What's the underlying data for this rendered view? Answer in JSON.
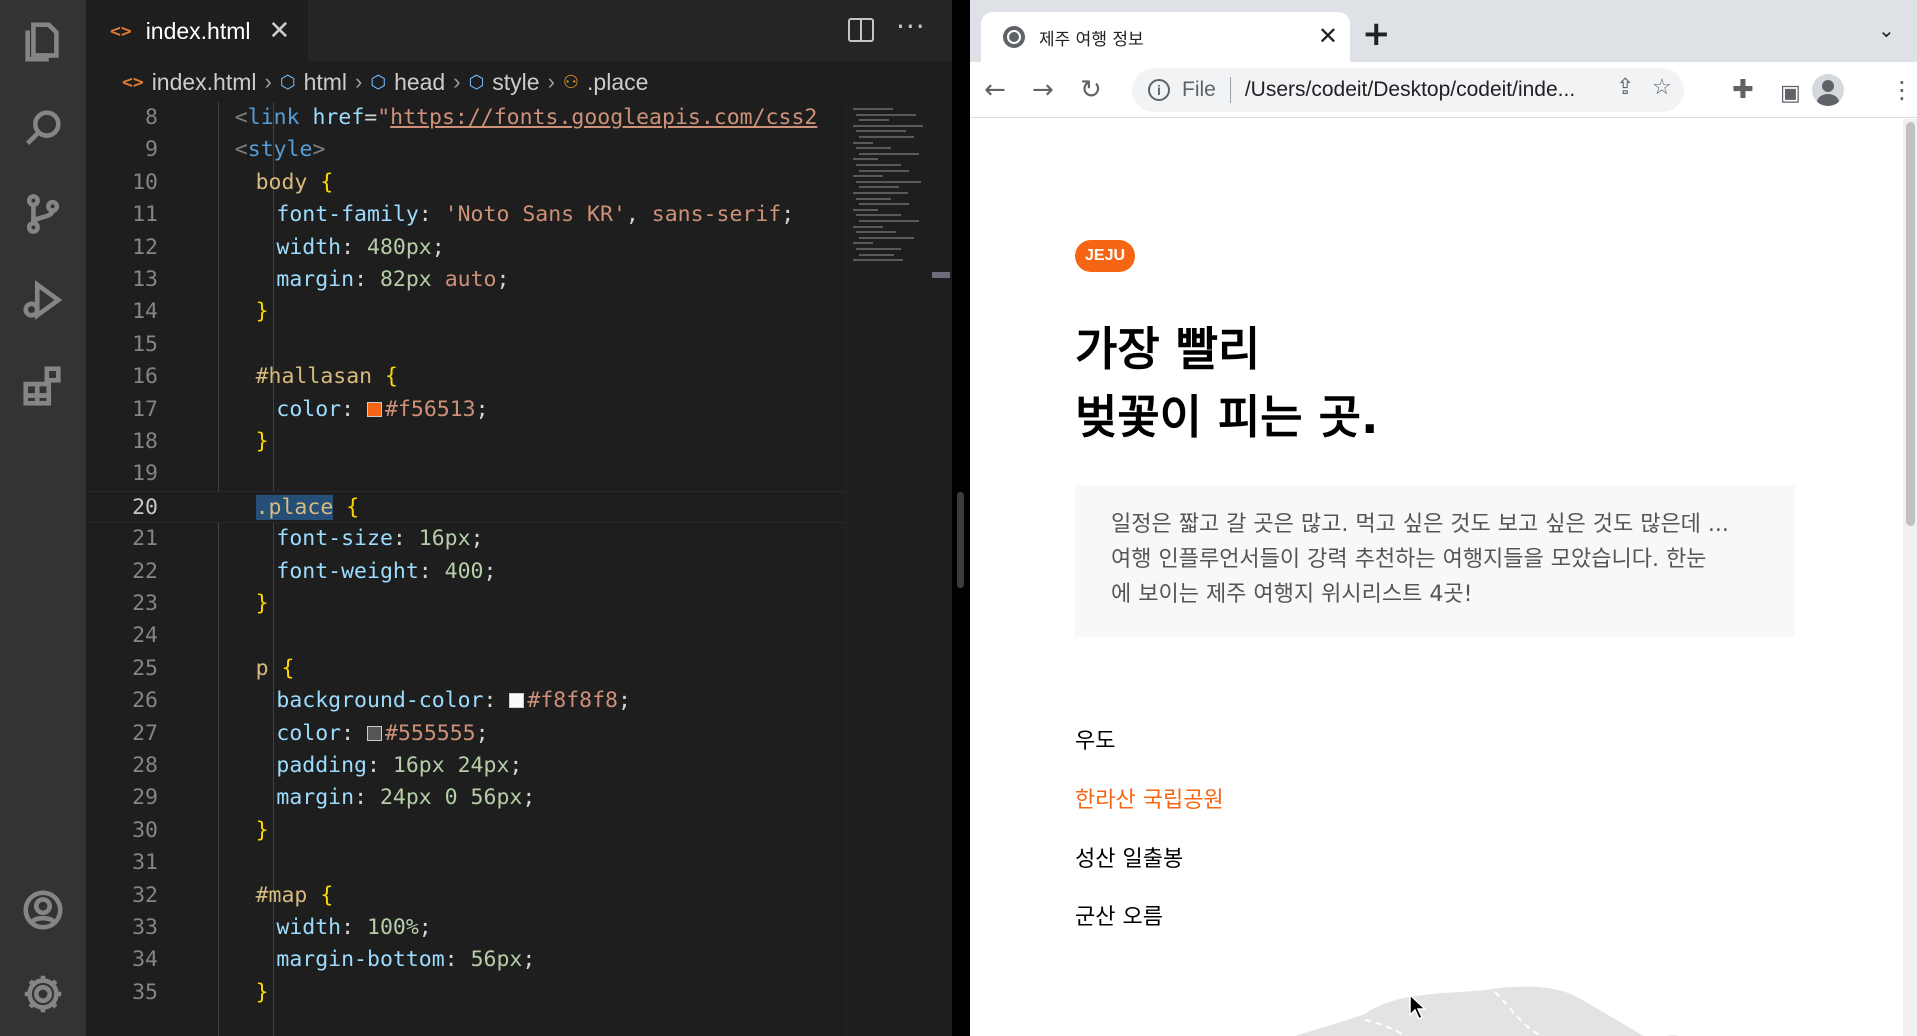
{
  "vscode": {
    "tab": {
      "icon": "<>",
      "label": "index.html",
      "close": "✕"
    },
    "breadcrumb": [
      {
        "label": "index.html",
        "icon": "html-file-icon",
        "glyph": "<>"
      },
      {
        "label": "html",
        "icon": "tag-icon",
        "glyph": "⬡"
      },
      {
        "label": "head",
        "icon": "tag-icon",
        "glyph": "⬡"
      },
      {
        "label": "style",
        "icon": "tag-icon",
        "glyph": "⬡"
      },
      {
        "label": ".place",
        "icon": "css-selector-icon",
        "glyph": "⚇"
      }
    ],
    "active_line": 20,
    "lines": [
      {
        "n": "8",
        "indent": 2,
        "t": [
          [
            "c-tag",
            "<"
          ],
          [
            "c-tn",
            "link"
          ],
          [
            "c-pun",
            " "
          ],
          [
            "c-attr",
            "href"
          ],
          [
            "c-pun",
            "="
          ],
          [
            "c-str",
            "\""
          ],
          [
            "c-url",
            "https://fonts.googleapis.com/css2"
          ]
        ]
      },
      {
        "n": "9",
        "indent": 2,
        "t": [
          [
            "c-tag",
            "<"
          ],
          [
            "c-tn",
            "style"
          ],
          [
            "c-tag",
            ">"
          ]
        ]
      },
      {
        "n": "10",
        "indent": 4,
        "t": [
          [
            "c-sel",
            "body"
          ],
          [
            "c-pun",
            " "
          ],
          [
            "c-brace",
            "{"
          ]
        ]
      },
      {
        "n": "11",
        "indent": 6,
        "t": [
          [
            "c-prop",
            "font-family"
          ],
          [
            "c-pun",
            ": "
          ],
          [
            "c-val",
            "'Noto Sans KR'"
          ],
          [
            "c-pun",
            ", "
          ],
          [
            "c-val",
            "sans-serif"
          ],
          [
            "c-pun",
            ";"
          ]
        ]
      },
      {
        "n": "12",
        "indent": 6,
        "t": [
          [
            "c-prop",
            "width"
          ],
          [
            "c-pun",
            ": "
          ],
          [
            "c-num",
            "480px"
          ],
          [
            "c-pun",
            ";"
          ]
        ]
      },
      {
        "n": "13",
        "indent": 6,
        "t": [
          [
            "c-prop",
            "margin"
          ],
          [
            "c-pun",
            ": "
          ],
          [
            "c-num",
            "82px"
          ],
          [
            "c-pun",
            " "
          ],
          [
            "c-val",
            "auto"
          ],
          [
            "c-pun",
            ";"
          ]
        ]
      },
      {
        "n": "14",
        "indent": 4,
        "t": [
          [
            "c-brace",
            "}"
          ]
        ]
      },
      {
        "n": "15",
        "indent": 0,
        "t": []
      },
      {
        "n": "16",
        "indent": 4,
        "t": [
          [
            "c-sel",
            "#hallasan"
          ],
          [
            "c-pun",
            " "
          ],
          [
            "c-brace",
            "{"
          ]
        ]
      },
      {
        "n": "17",
        "indent": 6,
        "t": [
          [
            "c-prop",
            "color"
          ],
          [
            "c-pun",
            ": "
          ],
          [
            "swatch",
            "#f56513"
          ],
          [
            "c-val",
            "#f56513"
          ],
          [
            "c-pun",
            ";"
          ]
        ]
      },
      {
        "n": "18",
        "indent": 4,
        "t": [
          [
            "c-brace",
            "}"
          ]
        ]
      },
      {
        "n": "19",
        "indent": 0,
        "t": []
      },
      {
        "n": "20",
        "indent": 4,
        "t": [
          [
            "c-sel c-hl",
            ".place"
          ],
          [
            "c-pun",
            " "
          ],
          [
            "c-brace",
            "{"
          ]
        ]
      },
      {
        "n": "21",
        "indent": 6,
        "t": [
          [
            "c-prop",
            "font-size"
          ],
          [
            "c-pun",
            ": "
          ],
          [
            "c-num",
            "16px"
          ],
          [
            "c-pun",
            ";"
          ]
        ]
      },
      {
        "n": "22",
        "indent": 6,
        "t": [
          [
            "c-prop",
            "font-weight"
          ],
          [
            "c-pun",
            ": "
          ],
          [
            "c-num",
            "400"
          ],
          [
            "c-pun",
            ";"
          ]
        ]
      },
      {
        "n": "23",
        "indent": 4,
        "t": [
          [
            "c-brace",
            "}"
          ]
        ]
      },
      {
        "n": "24",
        "indent": 0,
        "t": []
      },
      {
        "n": "25",
        "indent": 4,
        "t": [
          [
            "c-sel",
            "p"
          ],
          [
            "c-pun",
            " "
          ],
          [
            "c-brace",
            "{"
          ]
        ]
      },
      {
        "n": "26",
        "indent": 6,
        "t": [
          [
            "c-prop",
            "background-color"
          ],
          [
            "c-pun",
            ": "
          ],
          [
            "swatch",
            "#f8f8f8"
          ],
          [
            "c-val",
            "#f8f8f8"
          ],
          [
            "c-pun",
            ";"
          ]
        ]
      },
      {
        "n": "27",
        "indent": 6,
        "t": [
          [
            "c-prop",
            "color"
          ],
          [
            "c-pun",
            ": "
          ],
          [
            "swatch",
            "#555555"
          ],
          [
            "c-val",
            "#555555"
          ],
          [
            "c-pun",
            ";"
          ]
        ]
      },
      {
        "n": "28",
        "indent": 6,
        "t": [
          [
            "c-prop",
            "padding"
          ],
          [
            "c-pun",
            ": "
          ],
          [
            "c-num",
            "16px 24px"
          ],
          [
            "c-pun",
            ";"
          ]
        ]
      },
      {
        "n": "29",
        "indent": 6,
        "t": [
          [
            "c-prop",
            "margin"
          ],
          [
            "c-pun",
            ": "
          ],
          [
            "c-num",
            "24px 0 56px"
          ],
          [
            "c-pun",
            ";"
          ]
        ]
      },
      {
        "n": "30",
        "indent": 4,
        "t": [
          [
            "c-brace",
            "}"
          ]
        ]
      },
      {
        "n": "31",
        "indent": 0,
        "t": []
      },
      {
        "n": "32",
        "indent": 4,
        "t": [
          [
            "c-sel",
            "#map"
          ],
          [
            "c-pun",
            " "
          ],
          [
            "c-brace",
            "{"
          ]
        ]
      },
      {
        "n": "33",
        "indent": 6,
        "t": [
          [
            "c-prop",
            "width"
          ],
          [
            "c-pun",
            ": "
          ],
          [
            "c-num",
            "100%"
          ],
          [
            "c-pun",
            ";"
          ]
        ]
      },
      {
        "n": "34",
        "indent": 6,
        "t": [
          [
            "c-prop",
            "margin-bottom"
          ],
          [
            "c-pun",
            ": "
          ],
          [
            "c-num",
            "56px"
          ],
          [
            "c-pun",
            ";"
          ]
        ]
      },
      {
        "n": "35",
        "indent": 4,
        "t": [
          [
            "c-brace",
            "}"
          ]
        ]
      }
    ],
    "activity_icons": [
      "explorer-icon",
      "search-icon",
      "source-control-icon",
      "run-debug-icon",
      "extensions-icon",
      "accounts-icon",
      "settings-gear-icon"
    ]
  },
  "browser": {
    "tab_title": "제주 여행 정보",
    "tab_close": "✕",
    "new_tab": "+",
    "scheme": "File",
    "url": "/Users/codeit/Desktop/codeit/inde...",
    "page": {
      "badge": "JEJU",
      "headline_1": "가장 빨리",
      "headline_2": "벚꽃이 피는 곳.",
      "intro_1": "일정은 짧고 갈 곳은 많고. 먹고 싶은 것도 보고 싶은 것도 많은데 ...",
      "intro_2": "여행 인플루언서들이 강력 추천하는 여행지들을 모았습니다. 한눈",
      "intro_3": "에 보이는 제주 여행지 위시리스트 4곳!",
      "places": [
        "우도",
        "한라산 국립공원",
        "성산 일출봉",
        "군산 오름"
      ]
    }
  },
  "colors": {
    "accent": "#f56513",
    "intro_bg": "#f8f8f8",
    "intro_text": "#555555"
  }
}
